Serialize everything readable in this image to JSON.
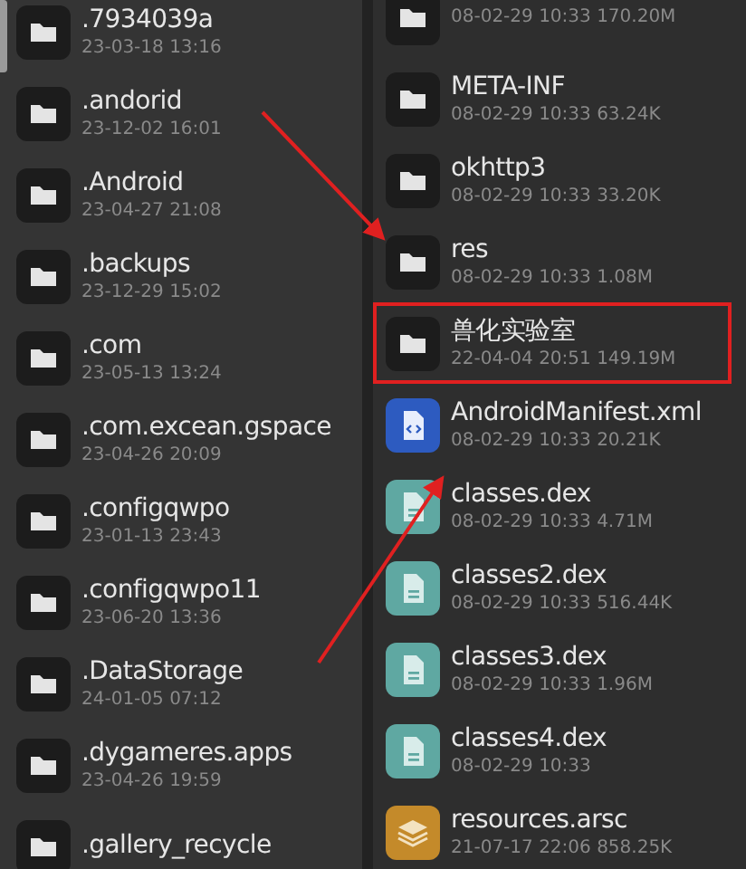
{
  "panes": [
    {
      "items": [
        {
          "kind": "folder",
          "name": ".7934039a",
          "details": "23-03-18 13:16"
        },
        {
          "kind": "folder",
          "name": ".andorid",
          "details": "23-12-02 16:01"
        },
        {
          "kind": "folder",
          "name": ".Android",
          "details": "23-04-27 21:08"
        },
        {
          "kind": "folder",
          "name": ".backups",
          "details": "23-12-29 15:02"
        },
        {
          "kind": "folder",
          "name": ".com",
          "details": "23-05-13 13:24"
        },
        {
          "kind": "folder",
          "name": ".com.excean.gspace",
          "details": "23-04-26 20:09"
        },
        {
          "kind": "folder",
          "name": ".configqwpo",
          "details": "23-01-13 23:43"
        },
        {
          "kind": "folder",
          "name": ".configqwpo11",
          "details": "23-06-20 13:36"
        },
        {
          "kind": "folder",
          "name": ".DataStorage",
          "details": "24-01-05 07:12"
        },
        {
          "kind": "folder",
          "name": ".dygameres.apps",
          "details": "23-04-26 19:59"
        },
        {
          "kind": "folder",
          "name": ".gallery_recycle"
        }
      ]
    },
    {
      "items": [
        {
          "kind": "folder",
          "details": "08-02-29 10:33  170.20M",
          "highlighted": false
        },
        {
          "kind": "folder",
          "name": "META-INF",
          "details": "08-02-29 10:33  63.24K",
          "highlighted": false
        },
        {
          "kind": "folder",
          "name": "okhttp3",
          "details": "08-02-29 10:33  33.20K",
          "highlighted": false
        },
        {
          "kind": "folder",
          "name": "res",
          "details": "08-02-29 10:33  1.08M",
          "highlighted": false
        },
        {
          "kind": "folder",
          "name": "兽化实验室",
          "details": "22-04-04 20:51  149.19M",
          "highlighted": true
        },
        {
          "kind": "xml",
          "name": "AndroidManifest.xml",
          "details": "08-02-29 10:33  20.21K",
          "highlighted": false
        },
        {
          "kind": "dex",
          "name": "classes.dex",
          "details": "08-02-29 10:33  4.71M",
          "highlighted": false
        },
        {
          "kind": "dex",
          "name": "classes2.dex",
          "details": "08-02-29 10:33  516.44K",
          "highlighted": false
        },
        {
          "kind": "dex",
          "name": "classes3.dex",
          "details": "08-02-29 10:33  1.96M",
          "highlighted": false
        },
        {
          "kind": "dex",
          "name": "classes4.dex",
          "details": "08-02-29 10:33",
          "highlighted": false
        },
        {
          "kind": "arsc",
          "name": "resources.arsc",
          "details": "21-07-17 22:06  858.25K",
          "highlighted": false
        }
      ]
    }
  ]
}
